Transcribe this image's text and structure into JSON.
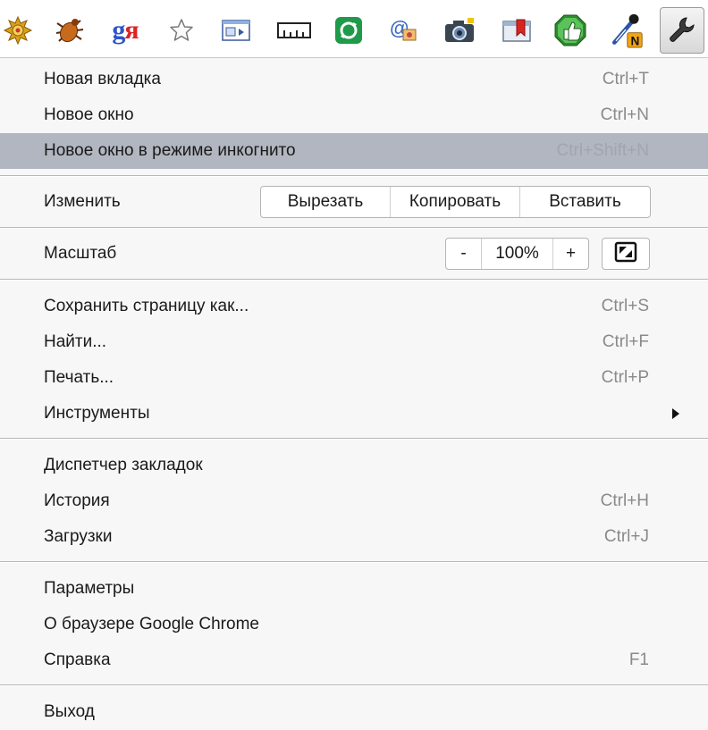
{
  "toolbar": {
    "icons": [
      "gear-sun-icon",
      "bug-icon",
      "yandex-icon",
      "star-icon",
      "window-icon",
      "ruler-icon",
      "sync-icon",
      "email-stamp-icon",
      "camera-icon",
      "bookmark-folder-icon",
      "thumbs-up-icon",
      "eyedropper-icon",
      "wrench-icon"
    ],
    "yandex_g": "g",
    "yandex_ya": "я",
    "eyedropper_badge": "N"
  },
  "menu": {
    "new_tab": {
      "label": "Новая вкладка",
      "shortcut": "Ctrl+T"
    },
    "new_window": {
      "label": "Новое окно",
      "shortcut": "Ctrl+N"
    },
    "incognito": {
      "label": "Новое окно в режиме инкогнито",
      "shortcut": "Ctrl+Shift+N"
    },
    "edit": {
      "label": "Изменить",
      "cut": "Вырезать",
      "copy": "Копировать",
      "paste": "Вставить"
    },
    "zoom": {
      "label": "Масштаб",
      "minus": "-",
      "value": "100%",
      "plus": "+"
    },
    "save_as": {
      "label": "Сохранить страницу как...",
      "shortcut": "Ctrl+S"
    },
    "find": {
      "label": "Найти...",
      "shortcut": "Ctrl+F"
    },
    "print": {
      "label": "Печать...",
      "shortcut": "Ctrl+P"
    },
    "tools": {
      "label": "Инструменты"
    },
    "bookmarks": {
      "label": "Диспетчер закладок"
    },
    "history": {
      "label": "История",
      "shortcut": "Ctrl+H"
    },
    "downloads": {
      "label": "Загрузки",
      "shortcut": "Ctrl+J"
    },
    "settings": {
      "label": "Параметры"
    },
    "about": {
      "label": "О браузере Google Chrome"
    },
    "help": {
      "label": "Справка",
      "shortcut": "F1"
    },
    "exit": {
      "label": "Выход"
    }
  },
  "colors": {
    "highlight": "#b2b6c0",
    "menu_bg": "#f7f7f7",
    "shortcut_text": "#8a8a8a"
  }
}
